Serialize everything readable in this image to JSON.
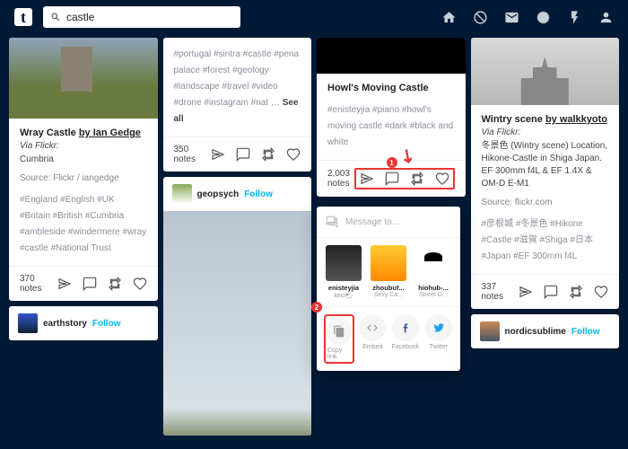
{
  "search": {
    "value": "castle"
  },
  "col1": {
    "wray": {
      "title_pre": "Wray Castle ",
      "title_link": "by Ian Gedge",
      "via": "Via Flickr:",
      "desc": "Cumbria",
      "source": "Source: Flickr / iangedge",
      "tags": "#England  #English  #UK  #Britain  #British  #Cumbria  #ambleside  #windermere  #wray  #castle  #National Trust",
      "notes": "370 notes"
    },
    "earthstory": {
      "name": "earthstory",
      "follow": "Follow"
    }
  },
  "col2": {
    "top": {
      "tags": "#portugal  #sintra  #castle  #pena palace  #forest  #geology  #landscape  #travel  #video  #drone  #instagram  #nat … ",
      "seeall": "See all",
      "notes": "350 notes"
    },
    "geopsych": {
      "name": "geopsych",
      "follow": "Follow"
    }
  },
  "col3": {
    "howl": {
      "title": "Howl's Moving Castle",
      "tags": "#enisteyjia  #piano  #howl's moving castle  #dark  #black and white",
      "notes": "2,003 notes"
    }
  },
  "share": {
    "placeholder": "Message to...",
    "users": [
      {
        "name": "enisteyjia",
        "sub": "keci🐑"
      },
      {
        "name": "zhoubuf...",
        "sub": "Sexy Ca..."
      },
      {
        "name": "hiohub-...",
        "sub": "Street D..."
      }
    ],
    "social": [
      {
        "id": "copylink",
        "label": "Copy link"
      },
      {
        "id": "embed",
        "label": "Embed"
      },
      {
        "id": "facebook",
        "label": "Facebook"
      },
      {
        "id": "twitter",
        "label": "Twitter"
      }
    ],
    "badge1": "1",
    "badge2": "2"
  },
  "col4": {
    "wintry": {
      "title_pre": "Wintry scene ",
      "title_link": "by walkkyoto",
      "via": "Via Flickr:",
      "desc": "冬景色 (Wintry scene) Location, Hikone-Castle in Shiga Japan. EF 300mm f4L & EF 1.4X & OM-D E-M1",
      "source": "Source: flickr.com",
      "tags": "#彦根城  #冬景色  #Hikone  #Castle  #滋賀  #Shiga  #日本  #Japan  #EF 300mm f4L",
      "notes": "337 notes"
    },
    "nordic": {
      "name": "nordicsublime",
      "follow": "Follow"
    }
  }
}
